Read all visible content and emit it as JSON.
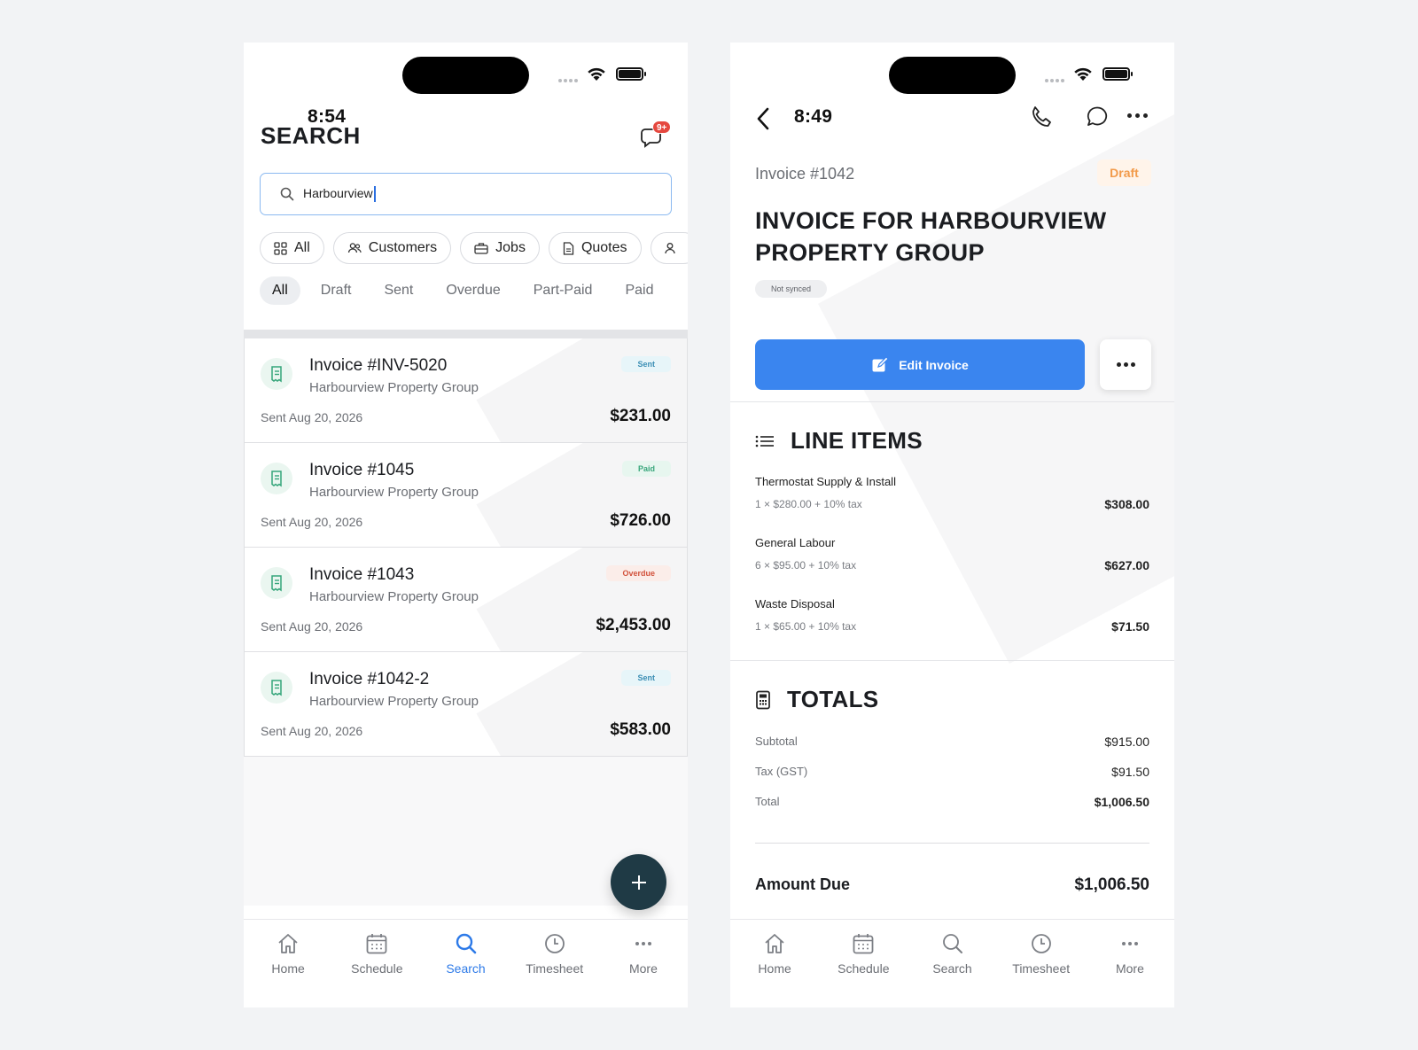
{
  "left": {
    "status_time": "8:54",
    "title": "SEARCH",
    "notification_badge": "9+",
    "search": {
      "value": "Harbourview"
    },
    "category_chips": [
      {
        "label": "All",
        "icon": "grid-icon"
      },
      {
        "label": "Customers",
        "icon": "users-icon"
      },
      {
        "label": "Jobs",
        "icon": "briefcase-icon"
      },
      {
        "label": "Quotes",
        "icon": "document-icon"
      },
      {
        "label": "",
        "icon": "user-icon"
      }
    ],
    "status_tabs": [
      "All",
      "Draft",
      "Sent",
      "Overdue",
      "Part-Paid",
      "Paid"
    ],
    "active_status": "All",
    "results": [
      {
        "title": "Invoice #INV-5020",
        "customer": "Harbourview Property Group",
        "date": "Sent Aug 20, 2026",
        "amount": "$231.00",
        "status": "Sent",
        "status_kind": "sent"
      },
      {
        "title": "Invoice #1045",
        "customer": "Harbourview Property Group",
        "date": "Sent Aug 20, 2026",
        "amount": "$726.00",
        "status": "Paid",
        "status_kind": "paid"
      },
      {
        "title": "Invoice #1043",
        "customer": "Harbourview Property Group",
        "date": "Sent Aug 20, 2026",
        "amount": "$2,453.00",
        "status": "Overdue",
        "status_kind": "overdue"
      },
      {
        "title": "Invoice #1042-2",
        "customer": "Harbourview Property Group",
        "date": "Sent Aug 20, 2026",
        "amount": "$583.00",
        "status": "Sent",
        "status_kind": "sent"
      }
    ],
    "tabbar": [
      {
        "label": "Home",
        "icon": "home-icon"
      },
      {
        "label": "Schedule",
        "icon": "calendar-icon"
      },
      {
        "label": "Search",
        "icon": "search-icon",
        "active": true
      },
      {
        "label": "Timesheet",
        "icon": "clock-icon"
      },
      {
        "label": "More",
        "icon": "more-icon"
      }
    ]
  },
  "right": {
    "status_time": "8:49",
    "invoice_number": "Invoice #1042",
    "status_badge": "Draft",
    "title": "INVOICE FOR HARBOURVIEW PROPERTY GROUP",
    "sync_status": "Not synced",
    "edit_button": "Edit Invoice",
    "line_items_title": "LINE ITEMS",
    "line_items": [
      {
        "name": "Thermostat Supply & Install",
        "detail": "1 × $280.00 + 10% tax",
        "amount": "$308.00"
      },
      {
        "name": "General Labour",
        "detail": "6 × $95.00 + 10% tax",
        "amount": "$627.00"
      },
      {
        "name": "Waste Disposal",
        "detail": "1 × $65.00 + 10% tax",
        "amount": "$71.50"
      }
    ],
    "totals_title": "TOTALS",
    "totals": [
      {
        "label": "Subtotal",
        "value": "$915.00"
      },
      {
        "label": "Tax (GST)",
        "value": "$91.50"
      },
      {
        "label": "Total",
        "value": "$1,006.50"
      }
    ],
    "amount_due_label": "Amount Due",
    "amount_due": "$1,006.50",
    "tabbar": [
      {
        "label": "Home",
        "icon": "home-icon"
      },
      {
        "label": "Schedule",
        "icon": "calendar-icon"
      },
      {
        "label": "Search",
        "icon": "search-icon"
      },
      {
        "label": "Timesheet",
        "icon": "clock-icon"
      },
      {
        "label": "More",
        "icon": "more-icon"
      }
    ]
  },
  "colors": {
    "accent_blue": "#3a85ef",
    "fab": "#1f3a45",
    "sent": "#3c8fb5",
    "paid": "#39a67c",
    "overdue": "#d2533d",
    "draft": "#f29a4a"
  }
}
